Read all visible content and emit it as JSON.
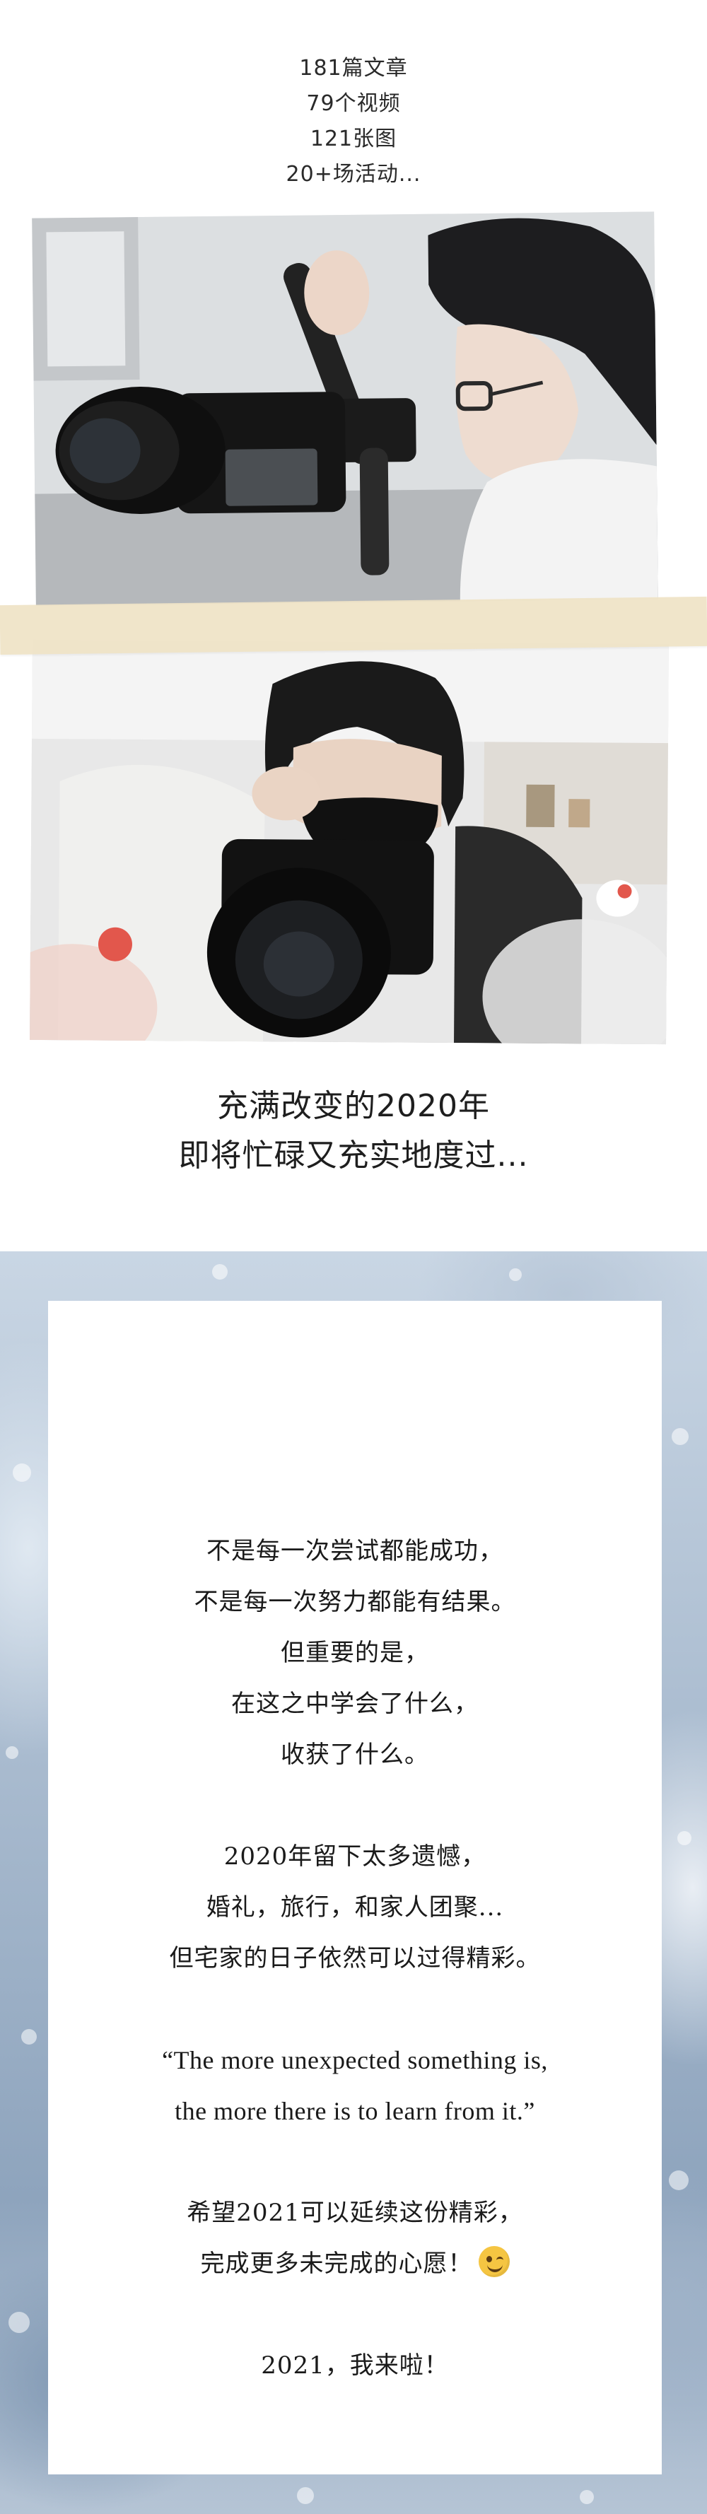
{
  "stats": [
    "181篇文章",
    "79个视频",
    "121张图",
    "20+场活动..."
  ],
  "headline": {
    "line1": "充满改变的2020年",
    "line2": "即将忙碌又充实地度过..."
  },
  "card": {
    "para1": [
      "不是每一次尝试都能成功，",
      "不是每一次努力都能有结果。",
      "但重要的是，",
      "在这之中学会了什么，",
      "收获了什么。"
    ],
    "para2": [
      "2020年留下太多遗憾，",
      "婚礼，旅行，和家人团聚...",
      "但宅家的日子依然可以过得精彩。"
    ],
    "quote": [
      "“The more unexpected something is,",
      "the more there is to learn from it.”"
    ],
    "para3": [
      "希望2021可以延续这份精彩，",
      "完成更多未完成的心愿！"
    ],
    "closing": "2021，我来啦！",
    "emoji": "wink-emoji"
  },
  "colors": {
    "text": "#1a1a1a",
    "tape": "#efe3c6",
    "frost": "#a9bbcf"
  }
}
